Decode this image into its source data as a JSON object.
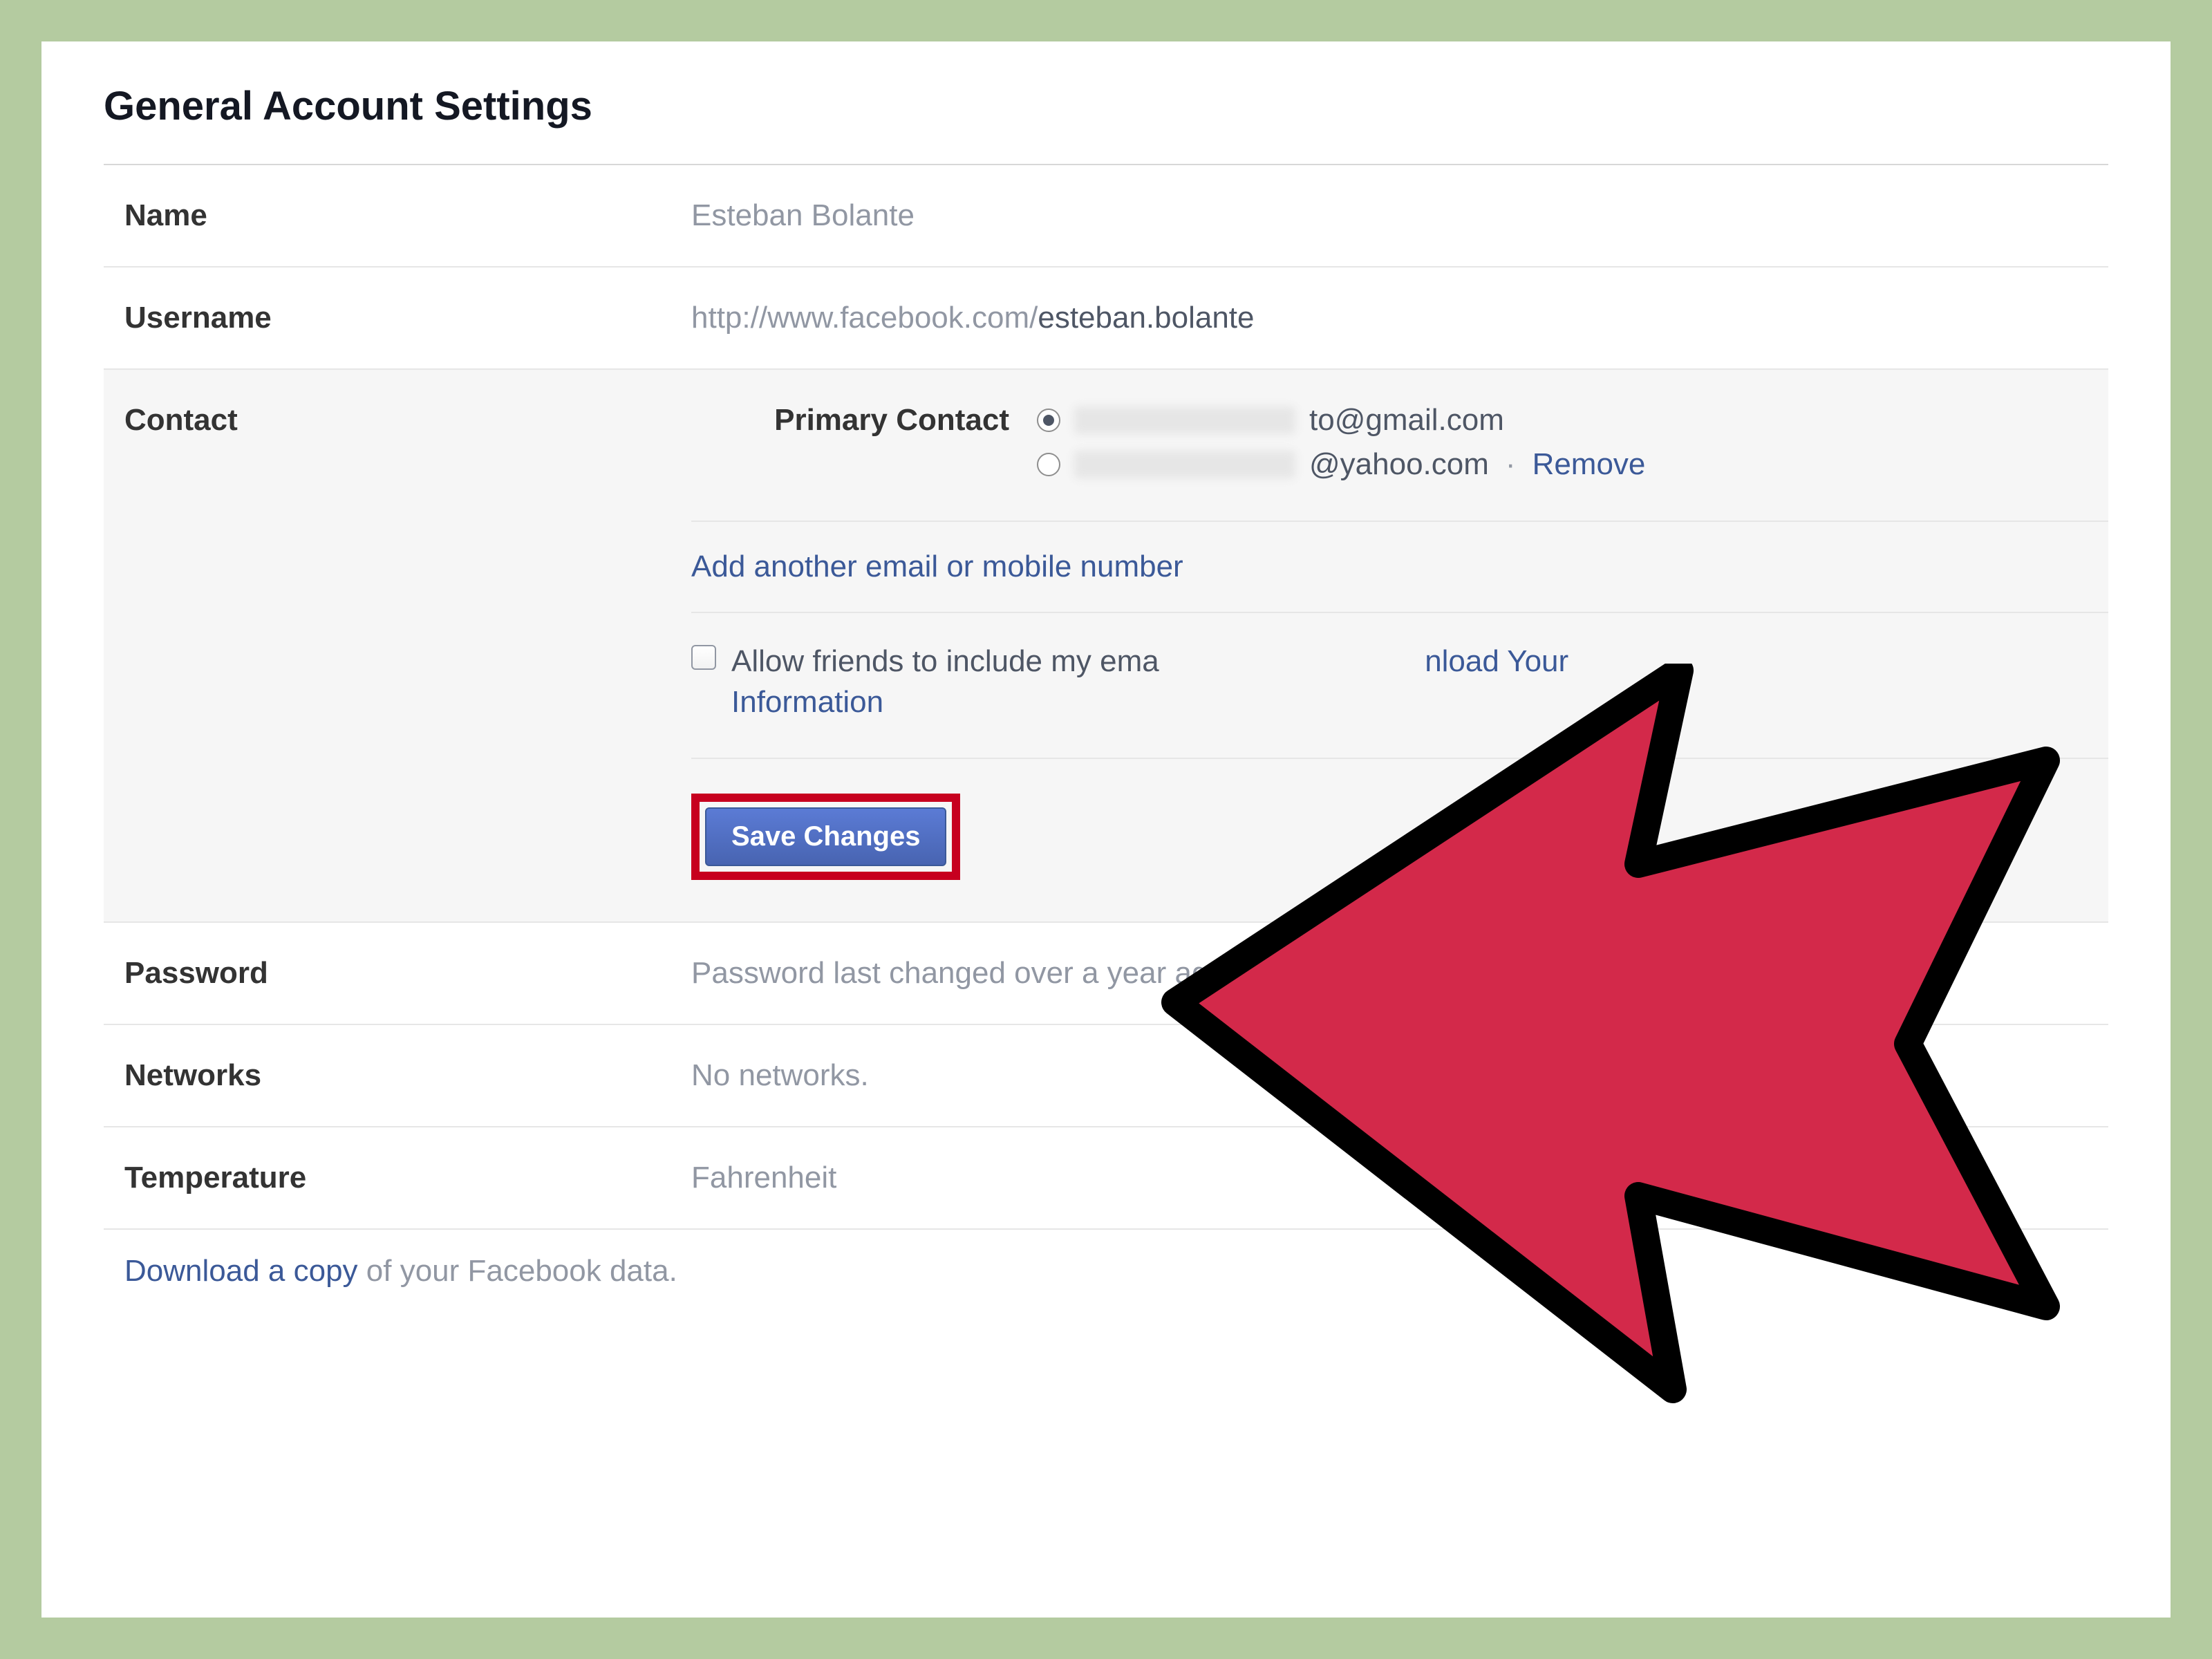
{
  "page": {
    "title": "General Account Settings"
  },
  "rows": {
    "name": {
      "label": "Name",
      "value": "Esteban Bolante"
    },
    "username": {
      "label": "Username",
      "url_prefix": "http://www.facebook.com/",
      "url_suffix": "esteban.bolante"
    },
    "contact": {
      "label": "Contact",
      "primary_label": "Primary Contact",
      "email1_suffix": "to@gmail.com",
      "email2_suffix": "@yahoo.com",
      "remove_label": "Remove",
      "add_another": "Add another email or mobile number",
      "allow_prefix": "Allow friends to include my ema",
      "allow_download": "nload Your",
      "allow_info": "Information",
      "save_label": "Save Changes"
    },
    "password": {
      "label": "Password",
      "value": "Password last changed over a year ago."
    },
    "networks": {
      "label": "Networks",
      "value": "No networks."
    },
    "temperature": {
      "label": "Temperature",
      "value": "Fahrenheit"
    }
  },
  "footer": {
    "link": "Download a copy",
    "suffix": " of your Facebook data."
  }
}
